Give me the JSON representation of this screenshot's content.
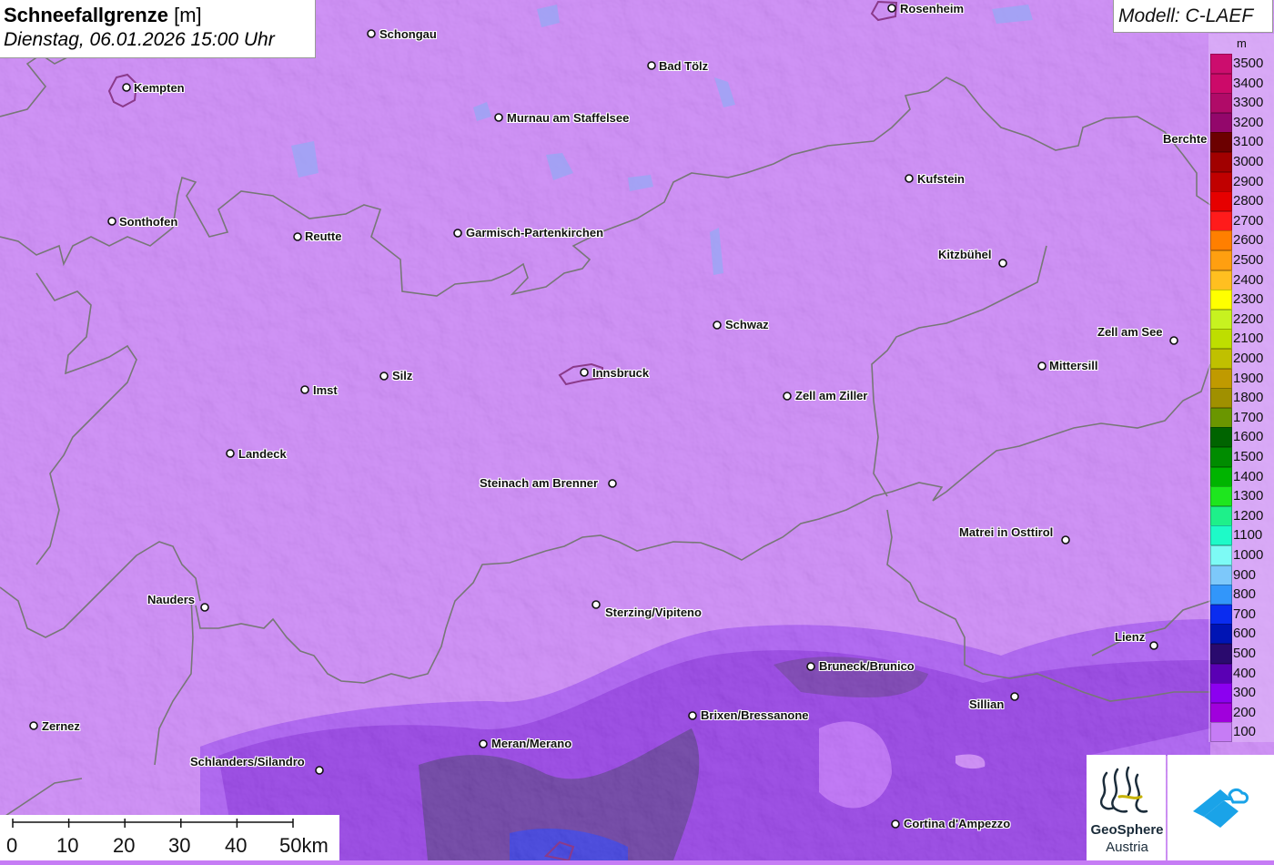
{
  "title": {
    "main": "Schneefallgrenze",
    "unit": "[m]",
    "datetime": "Dienstag, 06.01.2026 15:00 Uhr"
  },
  "model": "Modell: C-LAEF",
  "legend": {
    "unit": "m",
    "entries": [
      {
        "label": "3500",
        "color": "#cc0d6e"
      },
      {
        "label": "3400",
        "color": "#cc0a69"
      },
      {
        "label": "3300",
        "color": "#b00b68"
      },
      {
        "label": "3200",
        "color": "#93076b"
      },
      {
        "label": "3100",
        "color": "#6c0000"
      },
      {
        "label": "3000",
        "color": "#a10000"
      },
      {
        "label": "2900",
        "color": "#c00000"
      },
      {
        "label": "2800",
        "color": "#e60000"
      },
      {
        "label": "2700",
        "color": "#ff1b1b"
      },
      {
        "label": "2600",
        "color": "#ff7f00"
      },
      {
        "label": "2500",
        "color": "#ff9f10"
      },
      {
        "label": "2400",
        "color": "#ffbf20"
      },
      {
        "label": "2300",
        "color": "#ffff00"
      },
      {
        "label": "2200",
        "color": "#c7f220"
      },
      {
        "label": "2100",
        "color": "#bede00"
      },
      {
        "label": "2000",
        "color": "#c0c000"
      },
      {
        "label": "1900",
        "color": "#c09a00"
      },
      {
        "label": "1800",
        "color": "#a09000"
      },
      {
        "label": "1700",
        "color": "#6a9600"
      },
      {
        "label": "1600",
        "color": "#006400"
      },
      {
        "label": "1500",
        "color": "#008c00"
      },
      {
        "label": "1400",
        "color": "#00b400"
      },
      {
        "label": "1300",
        "color": "#1ee61e"
      },
      {
        "label": "1200",
        "color": "#1ef08a"
      },
      {
        "label": "1100",
        "color": "#1efac8"
      },
      {
        "label": "1000",
        "color": "#7dfaf5"
      },
      {
        "label": "900",
        "color": "#7dc8fa"
      },
      {
        "label": "800",
        "color": "#3296fa"
      },
      {
        "label": "700",
        "color": "#0a2cf0"
      },
      {
        "label": "600",
        "color": "#0014b4"
      },
      {
        "label": "500",
        "color": "#2a0a6e"
      },
      {
        "label": "400",
        "color": "#5a00b4"
      },
      {
        "label": "300",
        "color": "#8c00f0"
      },
      {
        "label": "200",
        "color": "#a000dc"
      },
      {
        "label": "100",
        "color": "#c67cf5"
      }
    ]
  },
  "scale": {
    "labels": [
      "0",
      "10",
      "20",
      "30",
      "40",
      "50km"
    ]
  },
  "logos": {
    "geosphere_line1": "GeoSphere",
    "geosphere_line2": "Austria"
  },
  "cities": [
    {
      "name": "Rosenheim"
    },
    {
      "name": "Schongau"
    },
    {
      "name": "Bad Tölz"
    },
    {
      "name": "Kempten"
    },
    {
      "name": "Murnau am Staffelsee"
    },
    {
      "name": "Berchte"
    },
    {
      "name": "Kufstein"
    },
    {
      "name": "Sonthofen"
    },
    {
      "name": "Reutte"
    },
    {
      "name": "Garmisch-Partenkirchen"
    },
    {
      "name": "Kitzbühel"
    },
    {
      "name": "Schwaz"
    },
    {
      "name": "Zell am See"
    },
    {
      "name": "Mittersill"
    },
    {
      "name": "Silz"
    },
    {
      "name": "Innsbruck"
    },
    {
      "name": "Imst"
    },
    {
      "name": "Zell am Ziller"
    },
    {
      "name": "Landeck"
    },
    {
      "name": "Steinach am Brenner"
    },
    {
      "name": "Matrei in Osttirol"
    },
    {
      "name": "Nauders"
    },
    {
      "name": "Sterzing/Vipiteno"
    },
    {
      "name": "Lienz"
    },
    {
      "name": "Bruneck/Brunico"
    },
    {
      "name": "Sillian"
    },
    {
      "name": "Brixen/Bressanone"
    },
    {
      "name": "Zernez"
    },
    {
      "name": "Meran/Merano"
    },
    {
      "name": "Schlanders/Silandro"
    },
    {
      "name": "Cortina d'Ampezzo"
    }
  ]
}
